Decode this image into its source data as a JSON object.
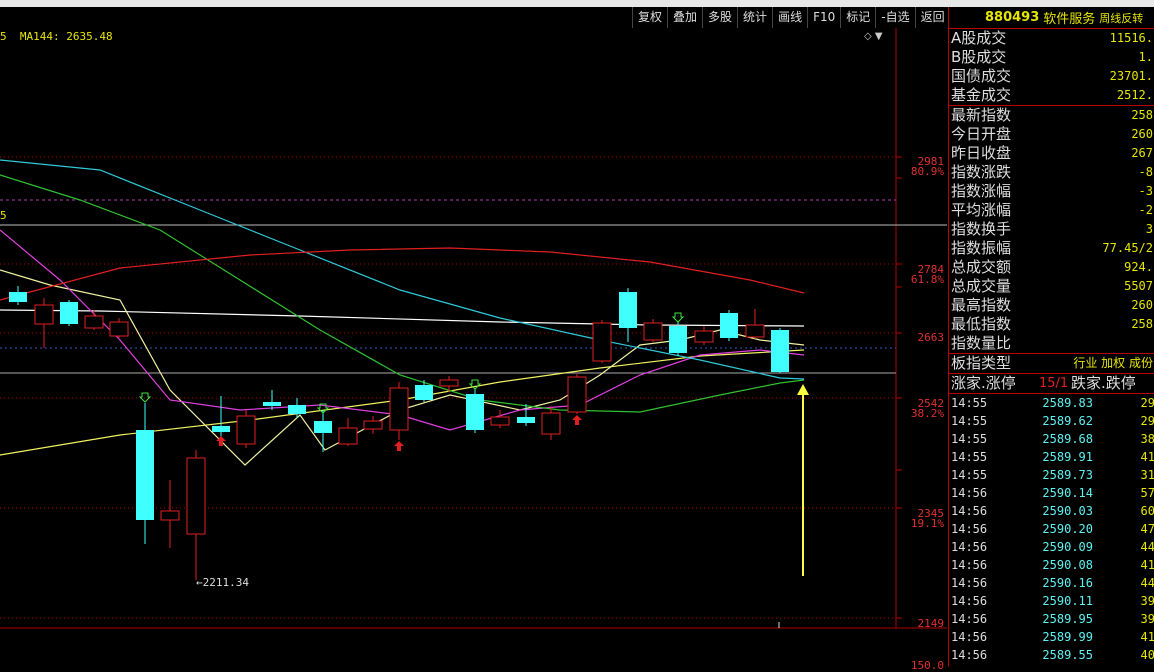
{
  "toolbar": {
    "items": [
      "复权",
      "叠加",
      "多股",
      "统计",
      "画线",
      "F10",
      "标记",
      "-自选",
      "返回"
    ]
  },
  "legend": {
    "ma_prefix": "5",
    "ma_text": "MA144: 2635.48"
  },
  "axis": {
    "labels": [
      {
        "value": "2981",
        "pct": "80.9%"
      },
      {
        "value": "2784",
        "pct": "61.8%"
      },
      {
        "value": "2663",
        "pct": ""
      },
      {
        "value": "2542",
        "pct": "38.2%"
      },
      {
        "value": "2345",
        "pct": "19.1%"
      },
      {
        "value": "2149",
        "pct": ""
      },
      {
        "value": "150.0",
        "pct": ""
      }
    ],
    "side_mark": "5"
  },
  "annotation": {
    "low_label": "2211.34"
  },
  "panel": {
    "code": "880493",
    "name": "软件服务",
    "tag": "周线反转",
    "market_rows": [
      {
        "label": "A股成交",
        "value": "11516."
      },
      {
        "label": "B股成交",
        "value": "1."
      },
      {
        "label": "国债成交",
        "value": "23701."
      },
      {
        "label": "基金成交",
        "value": "2512."
      }
    ],
    "stat_rows": [
      {
        "label": "最新指数",
        "value": "258"
      },
      {
        "label": "今日开盘",
        "value": "260"
      },
      {
        "label": "昨日收盘",
        "value": "267"
      },
      {
        "label": "指数涨跌",
        "value": "-8"
      },
      {
        "label": "指数涨幅",
        "value": "-3"
      },
      {
        "label": "平均涨幅",
        "value": "-2"
      },
      {
        "label": "指数换手",
        "value": "3"
      },
      {
        "label": "指数振幅",
        "value": "77.45/2"
      },
      {
        "label": "总成交额",
        "value": "924."
      },
      {
        "label": "总成交量",
        "value": "5507"
      },
      {
        "label": "最高指数",
        "value": "260"
      },
      {
        "label": "最低指数",
        "value": "258"
      },
      {
        "label": "指数量比",
        "value": ""
      }
    ],
    "type_row": {
      "label": "板指类型",
      "value": "行业 加权 成份"
    },
    "breadth": {
      "up_label": "涨家.涨停",
      "ratio": "15/1",
      "down_label": "跌家.跌停"
    },
    "ticks": [
      {
        "t": "14:55",
        "p": "2589.83",
        "v": "29"
      },
      {
        "t": "14:55",
        "p": "2589.62",
        "v": "29"
      },
      {
        "t": "14:55",
        "p": "2589.68",
        "v": "38"
      },
      {
        "t": "14:55",
        "p": "2589.91",
        "v": "41"
      },
      {
        "t": "14:55",
        "p": "2589.73",
        "v": "31"
      },
      {
        "t": "14:56",
        "p": "2590.14",
        "v": "57"
      },
      {
        "t": "14:56",
        "p": "2590.03",
        "v": "60"
      },
      {
        "t": "14:56",
        "p": "2590.20",
        "v": "47"
      },
      {
        "t": "14:56",
        "p": "2590.09",
        "v": "44"
      },
      {
        "t": "14:56",
        "p": "2590.08",
        "v": "41"
      },
      {
        "t": "14:56",
        "p": "2590.16",
        "v": "44"
      },
      {
        "t": "14:56",
        "p": "2590.11",
        "v": "39"
      },
      {
        "t": "14:56",
        "p": "2589.95",
        "v": "39"
      },
      {
        "t": "14:56",
        "p": "2589.99",
        "v": "41"
      },
      {
        "t": "14:56",
        "p": "2589.55",
        "v": "40"
      }
    ]
  },
  "colors": {
    "up": "#e02020",
    "down": "#40ffff",
    "grid": "#b00000",
    "ma_white": "#ffffff",
    "ma_yellow": "#f0f060",
    "ma_magenta": "#e040e0",
    "ma_green": "#30c030",
    "ma_cyan": "#30c8d8",
    "ma_red": "#e02020",
    "arrow": "#ffff40"
  }
}
